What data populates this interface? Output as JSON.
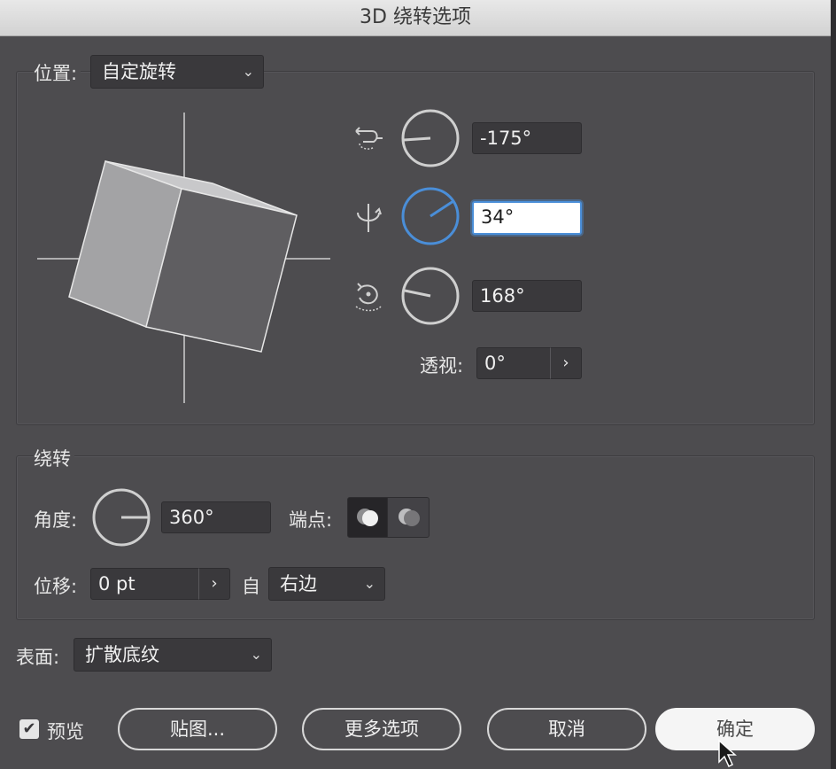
{
  "window": {
    "title": "3D 绕转选项"
  },
  "position": {
    "label": "位置:",
    "preset": "自定旋转",
    "x_angle": "-175°",
    "y_angle": "34°",
    "z_angle": "168°",
    "perspective_label": "透视:",
    "perspective": "0°"
  },
  "revolve": {
    "title": "绕转",
    "angle_label": "角度:",
    "angle": "360°",
    "cap_label": "端点:",
    "offset_label": "位移:",
    "offset": "0 pt",
    "from_label": "自",
    "from_value": "右边"
  },
  "surface": {
    "label": "表面:",
    "value": "扩散底纹"
  },
  "footer": {
    "preview_label": "预览",
    "preview_checked": true,
    "map_art": "贴图...",
    "more_options": "更多选项",
    "cancel": "取消",
    "ok": "确定"
  },
  "colors": {
    "background": "#4d4c4f",
    "accent": "#4a8ed8",
    "field": "#3a393c"
  },
  "icons": {
    "x_axis": "rotate-x-icon",
    "y_axis": "rotate-y-icon",
    "z_axis": "rotate-z-icon",
    "cap_on": "cap-on-icon",
    "cap_off": "cap-off-icon",
    "cursor": "mouse-pointer-icon"
  }
}
